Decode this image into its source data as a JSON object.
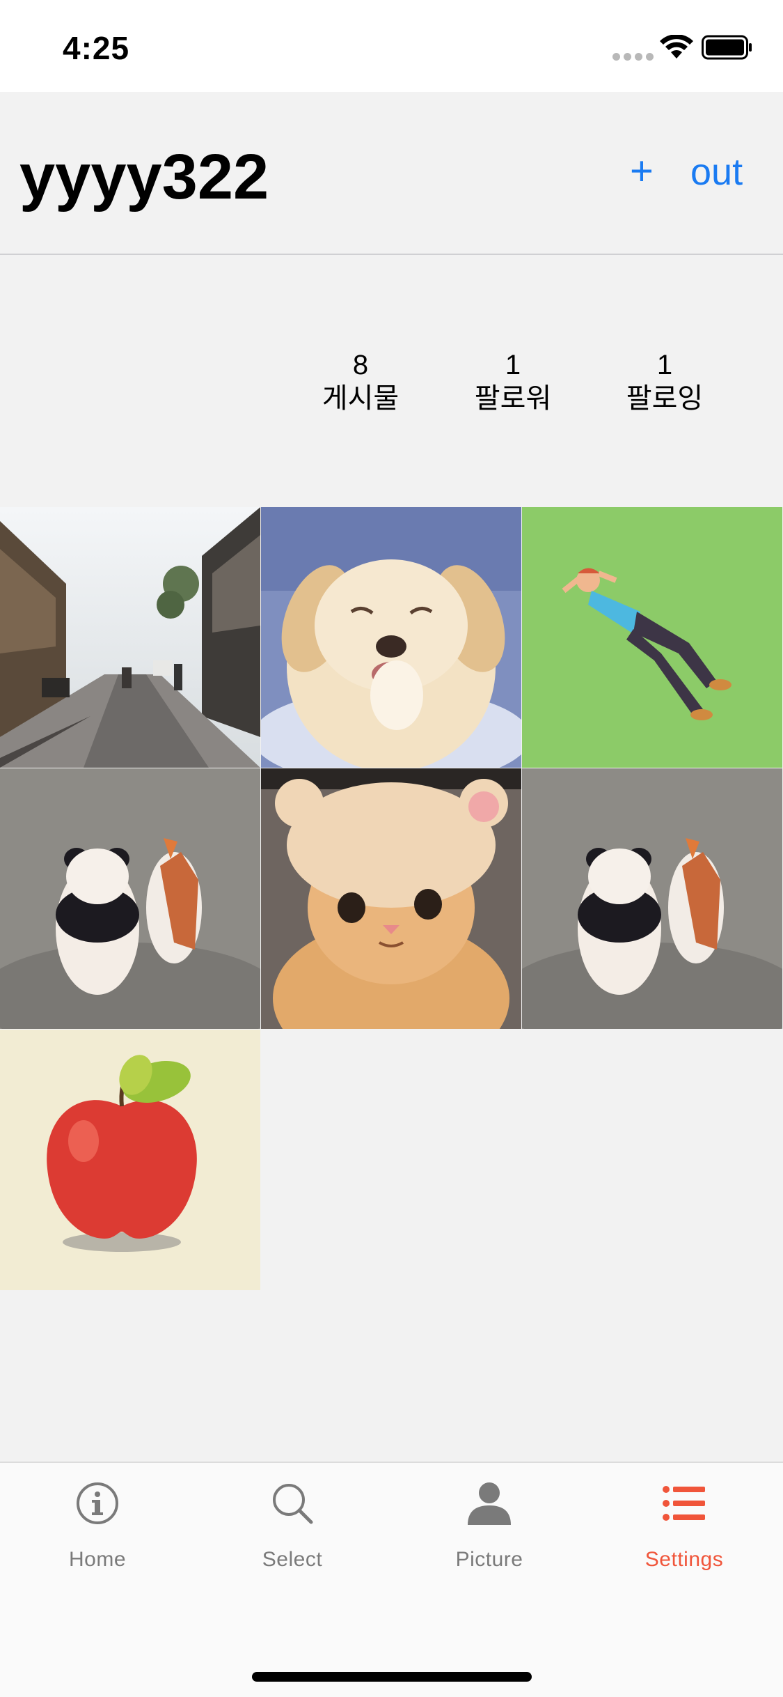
{
  "status_bar": {
    "time": "4:25"
  },
  "header": {
    "title": "yyyy322",
    "add_label": "+",
    "out_label": "out"
  },
  "stats": [
    {
      "value": "8",
      "label": "게시물"
    },
    {
      "value": "1",
      "label": "팔로워"
    },
    {
      "value": "1",
      "label": "팔로잉"
    }
  ],
  "photos": [
    {
      "subject": "street-photo"
    },
    {
      "subject": "laughing-puppy"
    },
    {
      "subject": "man-lying-on-grass"
    },
    {
      "subject": "panda-and-cat"
    },
    {
      "subject": "cat-in-bear-hat"
    },
    {
      "subject": "panda-and-cat"
    },
    {
      "subject": "red-apple"
    }
  ],
  "tabs": [
    {
      "label": "Home",
      "icon": "info-icon"
    },
    {
      "label": "Select",
      "icon": "search-icon"
    },
    {
      "label": "Picture",
      "icon": "person-icon"
    },
    {
      "label": "Settings",
      "icon": "list-icon"
    }
  ],
  "colors": {
    "accent": "#1a7bf2",
    "active_tab": "#f0553a",
    "inactive_tab": "#7a7a7a",
    "background": "#f2f2f2"
  }
}
